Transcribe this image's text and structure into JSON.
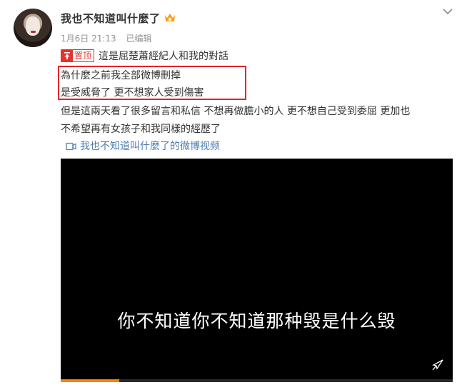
{
  "post": {
    "username": "我也不知道叫什麼了",
    "date": "1月6日 21:13",
    "edited_label": "已编辑",
    "pin_label": "置顶",
    "lines": [
      "這是屈楚蕭經紀人和我的對話",
      "為什麼之前我全部微博刪掉",
      "是受威脅了 更不想家人受到傷害",
      "但是這兩天看了很多留言和私信 不想再做膽小的人 更不想自己受到委屈 更加也",
      "不希望再有女孩子和我同樣的經歷了"
    ],
    "video_link_label": "我也不知道叫什麼了的微博视频"
  },
  "video": {
    "subtitle": "你不知道你不知道那种毁是什么毁",
    "progress_fraction": 0.15
  },
  "colors": {
    "accent_red": "#e5322d",
    "link_blue": "#507daf",
    "progress_orange": "#ff8200"
  },
  "icons": [
    "avatar",
    "vip-badge-icon",
    "chevron-down-icon",
    "pin-icon",
    "video-icon",
    "fullscreen-icon"
  ]
}
